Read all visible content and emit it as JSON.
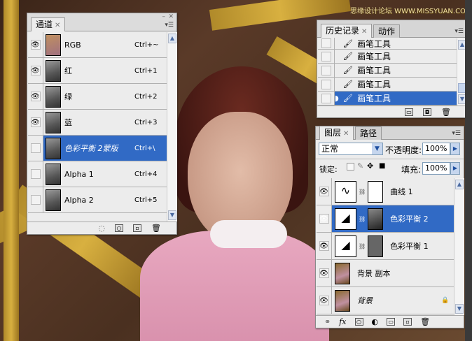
{
  "watermark": "思缘设计论坛 WWW.MISSYUAN.COM",
  "channels": {
    "tab": "通道",
    "rows": [
      {
        "name": "RGB",
        "shortcut": "Ctrl+~",
        "visible": true
      },
      {
        "name": "红",
        "shortcut": "Ctrl+1",
        "visible": true
      },
      {
        "name": "绿",
        "shortcut": "Ctrl+2",
        "visible": true
      },
      {
        "name": "蓝",
        "shortcut": "Ctrl+3",
        "visible": true
      },
      {
        "name": "色彩平衡 2蒙版",
        "shortcut": "Ctrl+\\",
        "visible": false,
        "selected": true
      },
      {
        "name": "Alpha 1",
        "shortcut": "Ctrl+4",
        "visible": false
      },
      {
        "name": "Alpha 2",
        "shortcut": "Ctrl+5",
        "visible": false
      }
    ]
  },
  "history": {
    "tabs": [
      "历史记录",
      "动作"
    ],
    "rows": [
      "画笔工具",
      "画笔工具",
      "画笔工具",
      "画笔工具",
      "画笔工具"
    ]
  },
  "layers": {
    "tabs": [
      "图层",
      "路径"
    ],
    "blend_mode": "正常",
    "opacity_label": "不透明度:",
    "opacity": "100%",
    "lock_label": "锁定:",
    "fill_label": "填充:",
    "fill": "100%",
    "rows": [
      {
        "name": "曲线 1",
        "type": "curves"
      },
      {
        "name": "色彩平衡 2",
        "type": "balance",
        "selected": true
      },
      {
        "name": "色彩平衡 1",
        "type": "balance"
      },
      {
        "name": "背景 副本",
        "type": "image"
      },
      {
        "name": "背景",
        "type": "image",
        "locked": true
      }
    ]
  },
  "colors": {
    "selection": "#316ac5",
    "panel": "#ececec"
  }
}
